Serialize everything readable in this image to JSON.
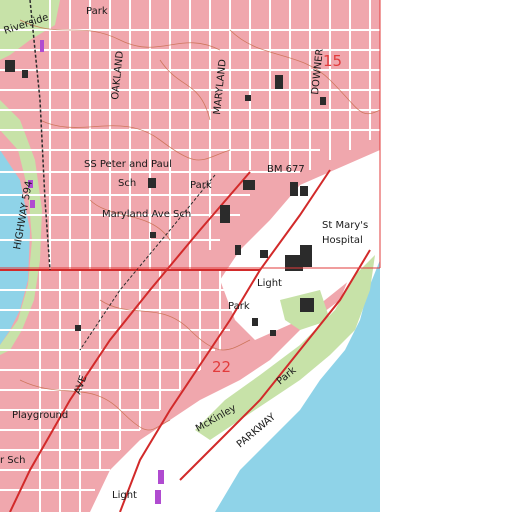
{
  "map": {
    "colors": {
      "urban": "#f0a7ad",
      "water": "#8fd3e8",
      "park": "#c7e2a8",
      "white": "#ffffff",
      "street": "#ffffff",
      "highway": "#d22a2a",
      "contour": "#c56a4a",
      "building": "#2b2b2b",
      "grid": "#e23b3b",
      "marker": "#b04bd0"
    },
    "labels": {
      "riverside": "Riverside",
      "park_top": "Park",
      "parkland": "OAKLAND",
      "maryland_ave_street": "MARYLAND",
      "downer": "DOWNER",
      "section_15": "15",
      "ss_peter_paul": "SS Peter and Paul",
      "sch_1": "Sch",
      "park_mid": "Park",
      "bm": "BM 677",
      "maryland_ave_sch": "Maryland Ave Sch",
      "st_marys": "St Mary's",
      "hospital": "Hospital",
      "highway_594": "HIGHWAY 594",
      "light_1": "Light",
      "park_low": "Park",
      "section_22": "22",
      "park_river": "Park",
      "mckinley": "McKinley",
      "parkway": "PARKWAY",
      "ave": "AVE",
      "playground": "Playground",
      "sch_bottom": "r Sch",
      "light_2": "Light"
    }
  }
}
